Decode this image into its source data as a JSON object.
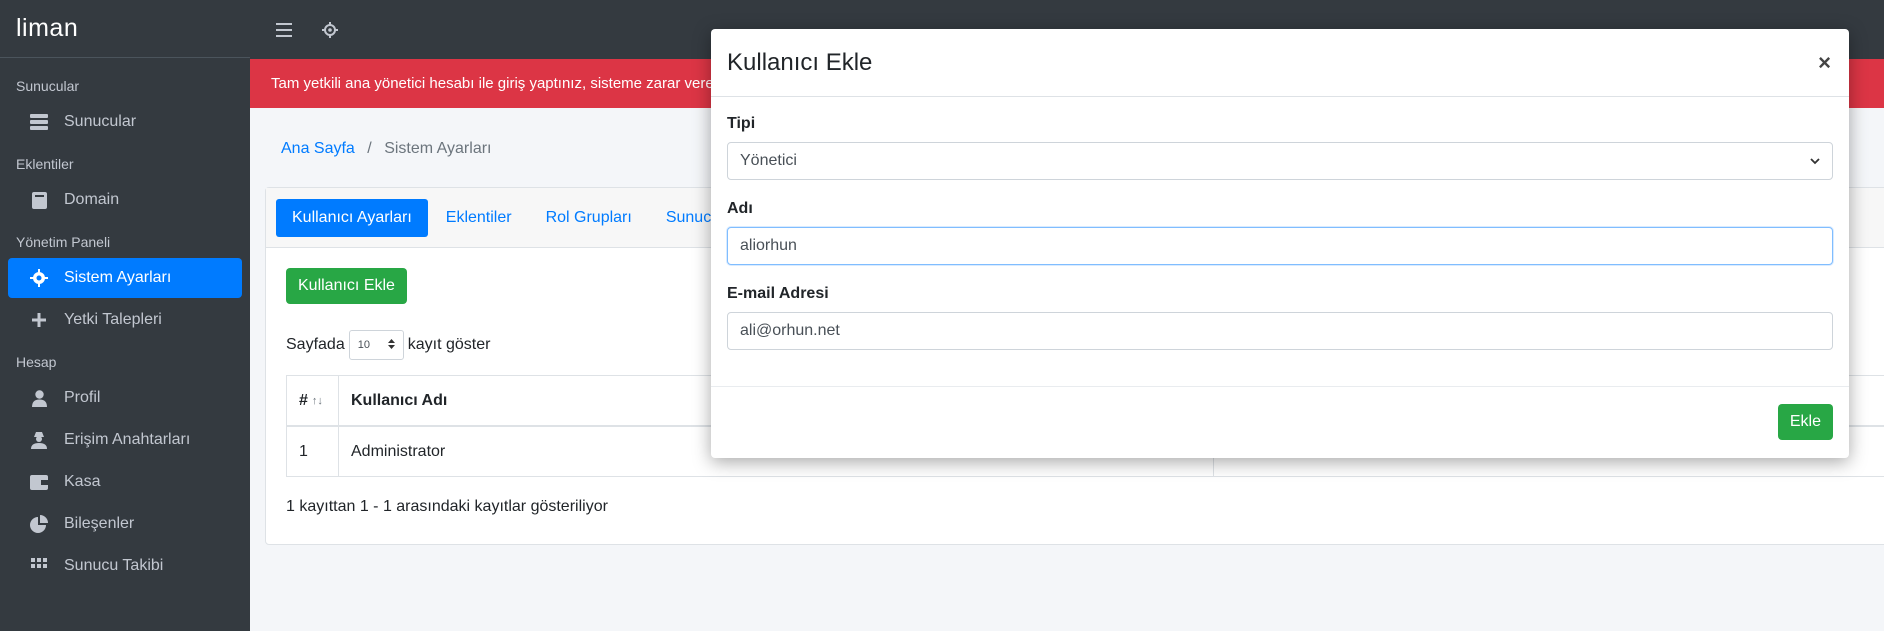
{
  "brand": "liman",
  "sidebar": {
    "sections": [
      {
        "header": "Sunucular",
        "items": [
          {
            "label": "Sunucular",
            "icon": "server-icon",
            "active": false
          }
        ]
      },
      {
        "header": "Eklentiler",
        "items": [
          {
            "label": "Domain",
            "icon": "book-icon",
            "active": false
          }
        ]
      },
      {
        "header": "Yönetim Paneli",
        "items": [
          {
            "label": "Sistem Ayarları",
            "icon": "gear-icon",
            "active": true
          },
          {
            "label": "Yetki Talepleri",
            "icon": "plus-icon",
            "active": false
          }
        ]
      },
      {
        "header": "Hesap",
        "items": [
          {
            "label": "Profil",
            "icon": "user-icon",
            "active": false
          },
          {
            "label": "Erişim Anahtarları",
            "icon": "user-secret-icon",
            "active": false
          },
          {
            "label": "Kasa",
            "icon": "wallet-icon",
            "active": false
          },
          {
            "label": "Bileşenler",
            "icon": "pie-chart-icon",
            "active": false
          },
          {
            "label": "Sunucu Takibi",
            "icon": "grid-icon",
            "active": false
          }
        ]
      }
    ]
  },
  "topbar": {
    "menu_icon": "hamburger-icon",
    "settings_icon": "cog-icon"
  },
  "alert": {
    "text": "Tam yetkili ana yönetici hesabı ile giriş yaptınız, sisteme zarar vere"
  },
  "breadcrumb": {
    "home": "Ana Sayfa",
    "separator": "/",
    "current": "Sistem Ayarları"
  },
  "tabs": [
    "Kullanıcı Ayarları",
    "Eklentiler",
    "Rol Grupları",
    "Sunucu G"
  ],
  "user_settings": {
    "add_button": "Kullanıcı Ekle",
    "length_prefix": "Sayfada",
    "length_value": "10",
    "length_suffix": "kayıt göster",
    "columns": [
      "#",
      "Kullanıcı Adı"
    ],
    "rows": [
      {
        "num": "1",
        "name": "Administrator"
      }
    ],
    "info": "1 kayıttan 1 - 1 arasındaki kayıtlar gösteriliyor"
  },
  "modal": {
    "title": "Kullanıcı Ekle",
    "close": "×",
    "type_label": "Tipi",
    "type_value": "Yönetici",
    "name_label": "Adı",
    "name_value": "aliorhun",
    "email_label": "E-mail Adresi",
    "email_value": "ali@orhun.net",
    "submit": "Ekle"
  },
  "colors": {
    "sidebar_bg": "#343a40",
    "primary": "#007bff",
    "success": "#28a745",
    "danger": "#dc3545"
  }
}
